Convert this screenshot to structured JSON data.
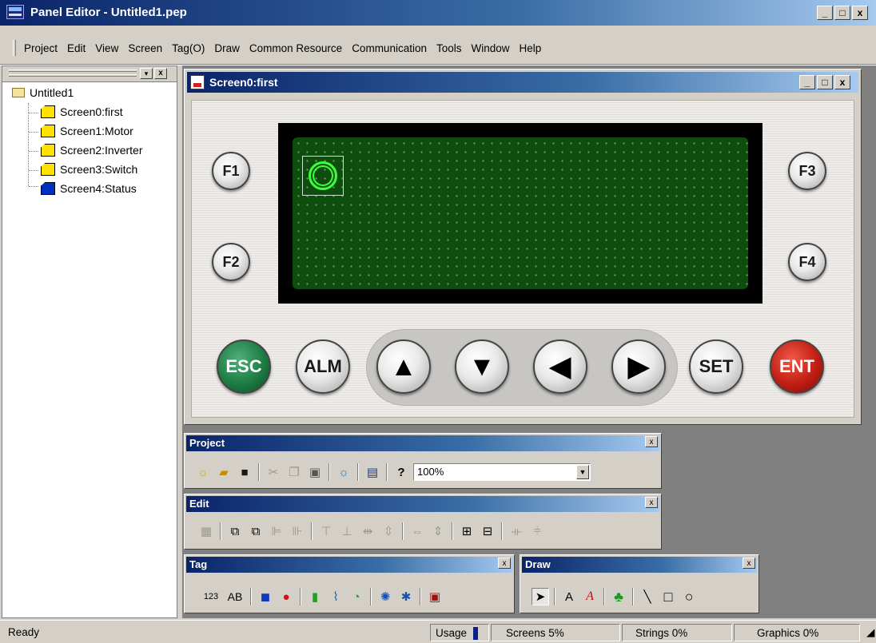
{
  "window": {
    "title": "Panel Editor - Untitled1.pep",
    "min": "_",
    "max": "□",
    "close": "x"
  },
  "menu": [
    "Project",
    "Edit",
    "View",
    "Screen",
    "Tag(O)",
    "Draw",
    "Common Resource",
    "Communication",
    "Tools",
    "Window",
    "Help"
  ],
  "tree": {
    "root": "Untitled1",
    "screens": [
      "Screen0:first",
      "Screen1:Motor",
      "Screen2:Inverter",
      "Screen3:Switch",
      "Screen4:Status"
    ]
  },
  "screen_window": {
    "title": "Screen0:first"
  },
  "device": {
    "fkeys": [
      "F1",
      "F2",
      "F3",
      "F4"
    ],
    "keys": {
      "esc": "ESC",
      "alm": "ALM",
      "up": "▲",
      "down": "▼",
      "left": "◀",
      "right": "▶",
      "set": "SET",
      "ent": "ENT"
    },
    "colors": {
      "lcd": "#0e4d0e",
      "esc": "#1e7c44",
      "ent": "#c21e14"
    }
  },
  "toolbars": {
    "project": {
      "title": "Project",
      "zoom": "100%",
      "icons": [
        "new-icon",
        "open-icon",
        "save-icon",
        "cut-icon",
        "copy-icon",
        "paste-icon",
        "new-screen-icon",
        "transfer-icon",
        "help-icon"
      ]
    },
    "edit": {
      "title": "Edit"
    },
    "tag": {
      "title": "Tag",
      "numeric_label": "123",
      "ascii_label": "AB"
    },
    "draw": {
      "title": "Draw",
      "text_label": "A",
      "italic_label": "A"
    }
  },
  "status": {
    "ready": "Ready",
    "usage": "Usage",
    "screens": "Screens  5%",
    "strings": "Strings  0%",
    "graphics": "Graphics  0%"
  }
}
